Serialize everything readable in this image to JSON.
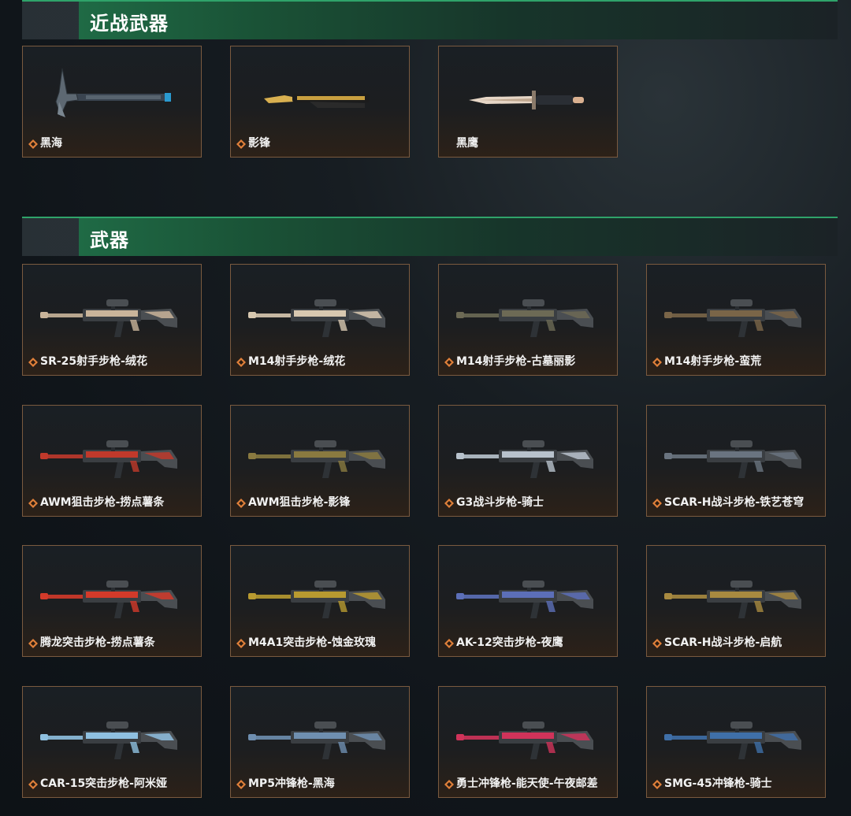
{
  "sections": {
    "melee": {
      "title": "近战武器",
      "items": [
        {
          "label": "黑海",
          "icon": "rank-icon",
          "accent": "#4a5560"
        },
        {
          "label": "影锋",
          "icon": "rank-icon",
          "accent": "#c9a040"
        },
        {
          "label": "黑鹰",
          "icon": "",
          "accent": "#d9c3b0"
        }
      ]
    },
    "weapons": {
      "title": "武器",
      "items": [
        {
          "label": "SR-25射手步枪-绒花",
          "accent": "#c9b49a"
        },
        {
          "label": "M14射手步枪-绒花",
          "accent": "#d8c8b0"
        },
        {
          "label": "M14射手步枪-古墓丽影",
          "accent": "#6d6a55"
        },
        {
          "label": "M14射手步枪-蛮荒",
          "accent": "#7a6548"
        },
        {
          "label": "AWM狙击步枪-捞点薯条",
          "accent": "#c0392b"
        },
        {
          "label": "AWM狙击步枪-影锋",
          "accent": "#8a7a40"
        },
        {
          "label": "G3战斗步枪-骑士",
          "accent": "#b8c2cc"
        },
        {
          "label": "SCAR-H战斗步枪-铁艺苍穹",
          "accent": "#6a7480"
        },
        {
          "label": "腾龙突击步枪-捞点薯条",
          "accent": "#d33a2a"
        },
        {
          "label": "M4A1突击步枪-蚀金玫瑰",
          "accent": "#b89a30"
        },
        {
          "label": "AK-12突击步枪-夜鹰",
          "accent": "#5c6fb8"
        },
        {
          "label": "SCAR-H战斗步枪-启航",
          "accent": "#a88a40"
        },
        {
          "label": "CAR-15突击步枪-阿米娅",
          "accent": "#8fc0e0"
        },
        {
          "label": "MP5冲锋枪-黑海",
          "accent": "#6f8fb0"
        },
        {
          "label": "勇士冲锋枪-能天使-午夜邮差",
          "accent": "#d0335a"
        },
        {
          "label": "SMG-45冲锋枪-骑士",
          "accent": "#3f6fa8"
        }
      ]
    }
  }
}
